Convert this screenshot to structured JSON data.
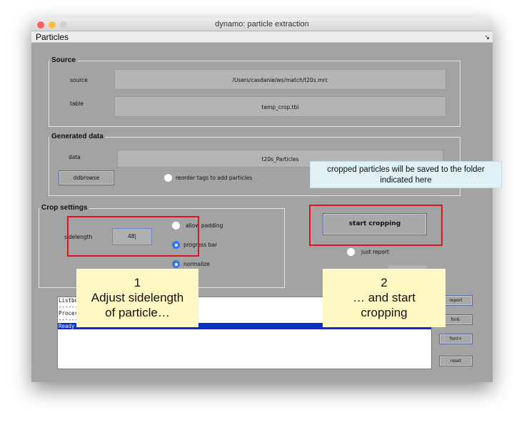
{
  "window": {
    "title": "dynamo: particle extraction",
    "menu": "Particles",
    "menu_arrow": "↘"
  },
  "source": {
    "title": "Source",
    "source_label": "source",
    "source_value": "/Users/casdanie/ws/match/t20s.mrc",
    "table_label": "table",
    "table_value": "temp_crop.tbl"
  },
  "generated": {
    "title": "Generated data",
    "data_label": "data",
    "data_value": "t20s_Particles",
    "ddbrowse_label": "ddbrowse",
    "reorder_label": "reorder tags to add particles"
  },
  "crop": {
    "title": "Crop settings",
    "sidelength_label": "sidelength",
    "sidelength_value": "48",
    "allow_padding_label": "allow padding",
    "progress_bar_label": "progress bar",
    "normalize_label": "normalize"
  },
  "actions": {
    "start_label": "start cropping",
    "just_report_label": "just report"
  },
  "listbox": {
    "rows": [
      "Listbox",
      "------",
      "Process",
      "------",
      "Ready"
    ]
  },
  "side_buttons": {
    "report": "report",
    "font_minus": "font-",
    "font_plus": "font+",
    "reset": "reset"
  },
  "annotations": {
    "tip": "cropped particles will be saved to the folder indicated here",
    "callout1_num": "1",
    "callout1_l1": "Adjust sidelength",
    "callout1_l2": "of particle…",
    "callout2_num": "2",
    "callout2_l1": "… and start",
    "callout2_l2": "cropping"
  },
  "colors": {
    "close": "#fc605c",
    "minimize": "#fdbc40",
    "zoom": "#d6d6d6",
    "highlight": "#e0141e",
    "selected_row": "#0a2fc4"
  }
}
